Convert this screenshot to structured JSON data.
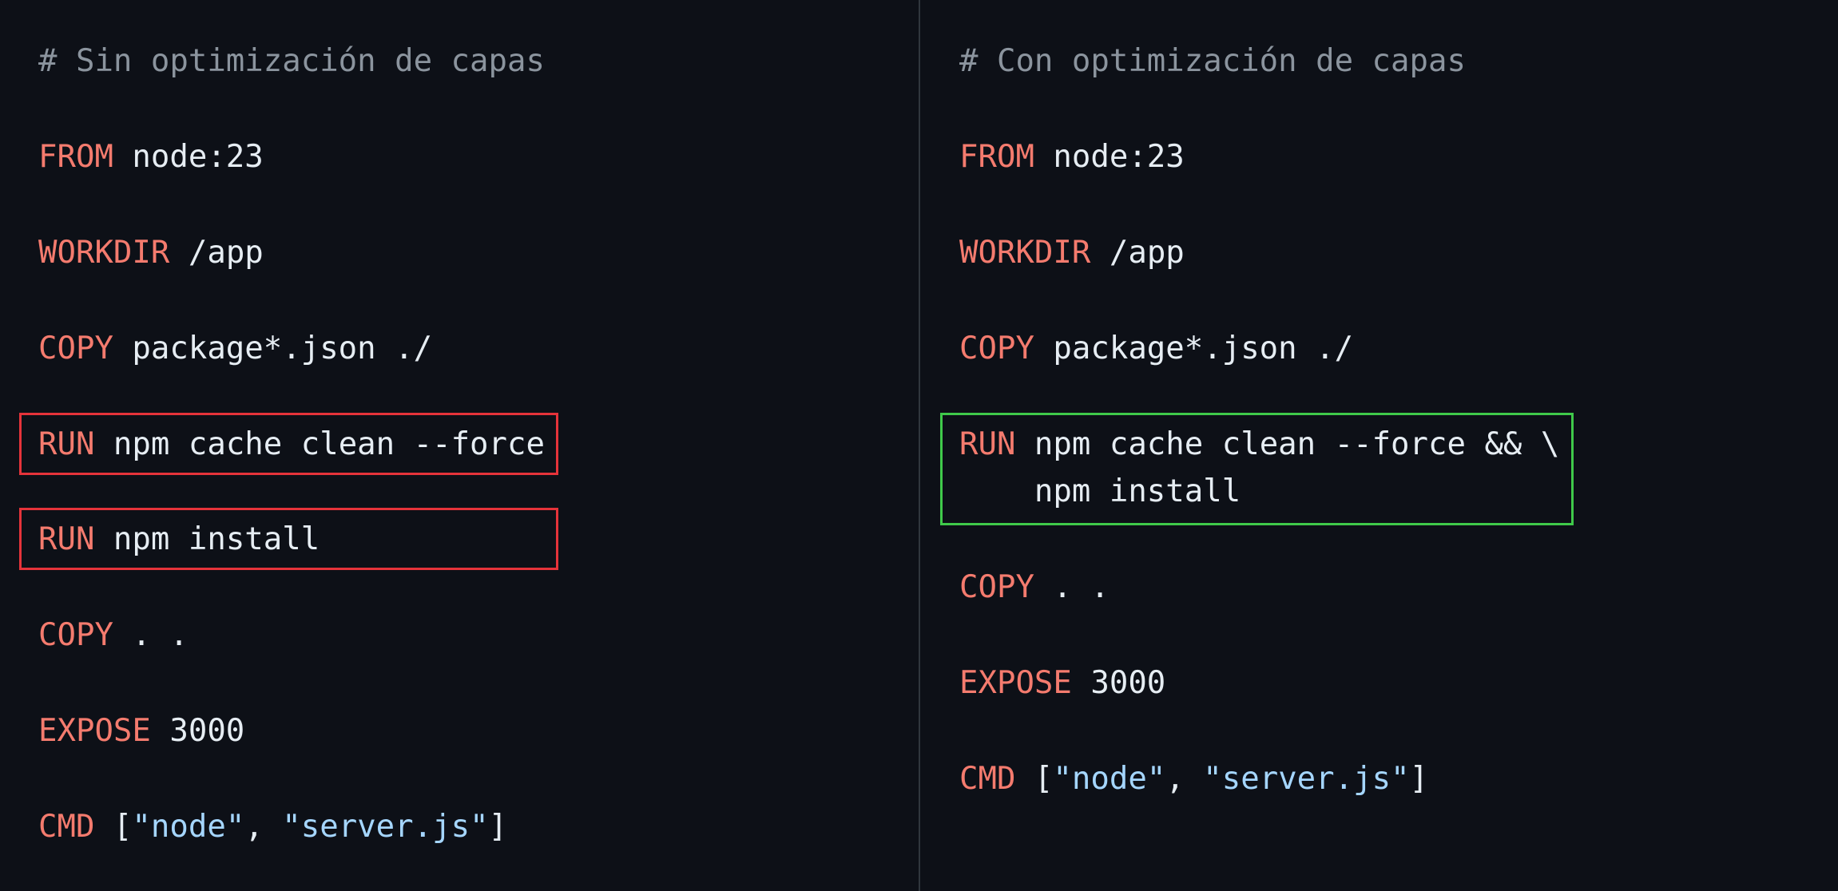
{
  "colors": {
    "background": "#0d1017",
    "keyword": "#f47b6e",
    "text": "#e6edf3",
    "comment": "#8b949e",
    "string": "#a5d6ff",
    "highlight_bad": "#e5333a",
    "highlight_good": "#3fc94a"
  },
  "left": {
    "comment": "# Sin optimización de capas",
    "from_kw": "FROM",
    "from_arg": " node:23",
    "workdir_kw": "WORKDIR",
    "workdir_arg": " /app",
    "copy1_kw": "COPY",
    "copy1_arg": " package*.json ./",
    "run1_kw": "RUN",
    "run1_arg": " npm cache clean --force",
    "run2_kw": "RUN",
    "run2_arg": " npm install",
    "copy2_kw": "COPY",
    "copy2_arg": " . .",
    "expose_kw": "EXPOSE",
    "expose_arg": " 3000",
    "cmd_kw": "CMD",
    "cmd_open": " [",
    "cmd_s1": "\"node\"",
    "cmd_sep": ", ",
    "cmd_s2": "\"server.js\"",
    "cmd_close": "]"
  },
  "right": {
    "comment": "# Con optimización de capas",
    "from_kw": "FROM",
    "from_arg": " node:23",
    "workdir_kw": "WORKDIR",
    "workdir_arg": " /app",
    "copy1_kw": "COPY",
    "copy1_arg": " package*.json ./",
    "run_kw": "RUN",
    "run_arg": " npm cache clean --force && \\",
    "run_cont": "    npm install",
    "copy2_kw": "COPY",
    "copy2_arg": " . .",
    "expose_kw": "EXPOSE",
    "expose_arg": " 3000",
    "cmd_kw": "CMD",
    "cmd_open": " [",
    "cmd_s1": "\"node\"",
    "cmd_sep": ", ",
    "cmd_s2": "\"server.js\"",
    "cmd_close": "]"
  }
}
